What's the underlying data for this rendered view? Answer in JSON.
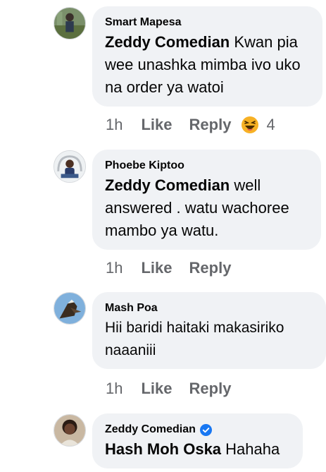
{
  "comments": [
    {
      "author": "Smart Mapesa",
      "mention": "Zeddy Comedian",
      "text": " Kwan pia wee unashka mimba ivo uko na order ya watoi",
      "time": "1h",
      "like": "Like",
      "reply": "Reply",
      "reaction_count": "4",
      "reaction_icon": "laughing-face-icon"
    },
    {
      "author": "Phoebe Kiptoo",
      "mention": "Zeddy Comedian",
      "text": " well answered . watu wachoree mambo ya watu.",
      "time": "1h",
      "like": "Like",
      "reply": "Reply"
    },
    {
      "author": "Mash Poa",
      "mention": "",
      "text": "Hii baridi haitaki makasiriko naaaniii",
      "time": "1h",
      "like": "Like",
      "reply": "Reply"
    },
    {
      "author": "Zeddy Comedian",
      "verified": true,
      "mention": "Hash Moh Oska",
      "text": " Hahaha"
    }
  ],
  "colors": {
    "bubble": "#f0f2f5",
    "meta_text": "#65676b",
    "verified": "#1877f2"
  }
}
